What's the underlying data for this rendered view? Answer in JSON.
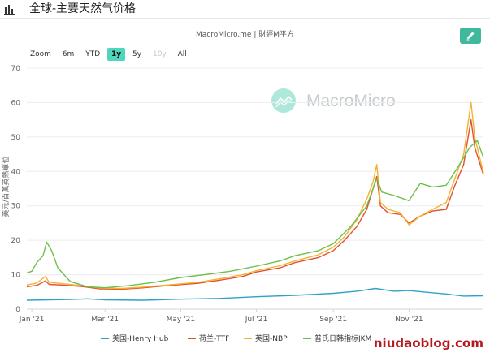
{
  "header": {
    "title": "全球-主要天然气价格",
    "icon": "bar-chart-icon"
  },
  "chart_source": "MacroMicro.me | 財經M平方",
  "brand": "MacroMicro",
  "zoom": {
    "label": "Zoom",
    "options": [
      "6m",
      "YTD",
      "1y",
      "5y",
      "10y",
      "All"
    ],
    "active": "1y",
    "disabled": [
      "10y"
    ]
  },
  "watermark": "niudaoblog.com",
  "colors": {
    "accent": "#4fd6bd",
    "edit_button": "#3fb89d"
  },
  "chart_data": {
    "type": "line",
    "title": "",
    "ylabel": "美元/百萬英熱單位",
    "ylim": [
      0,
      70
    ],
    "yticks": [
      0,
      10,
      20,
      30,
      40,
      50,
      60,
      70
    ],
    "xlim": [
      "2020-12-28",
      "2021-12-31"
    ],
    "xticks": [
      {
        "date": "2021-01-01",
        "label": "Jan '21"
      },
      {
        "date": "2021-03-01",
        "label": "Mar '21"
      },
      {
        "date": "2021-05-01",
        "label": "May '21"
      },
      {
        "date": "2021-07-01",
        "label": "Jul '21"
      },
      {
        "date": "2021-09-01",
        "label": "Sep '21"
      },
      {
        "date": "2021-11-01",
        "label": "Nov '21"
      }
    ],
    "grid": "horizontal",
    "legend_position": "bottom",
    "series": [
      {
        "name": "美国-Henry Hub",
        "color": "#2fa3c4",
        "points": [
          [
            "2020-12-28",
            2.6
          ],
          [
            "2021-01-15",
            2.7
          ],
          [
            "2021-02-01",
            2.8
          ],
          [
            "2021-02-15",
            3.0
          ],
          [
            "2021-03-01",
            2.7
          ],
          [
            "2021-04-01",
            2.6
          ],
          [
            "2021-05-01",
            2.9
          ],
          [
            "2021-06-01",
            3.1
          ],
          [
            "2021-07-01",
            3.6
          ],
          [
            "2021-08-01",
            4.0
          ],
          [
            "2021-09-01",
            4.6
          ],
          [
            "2021-09-20",
            5.2
          ],
          [
            "2021-10-05",
            6.0
          ],
          [
            "2021-10-20",
            5.2
          ],
          [
            "2021-11-01",
            5.4
          ],
          [
            "2021-11-15",
            4.9
          ],
          [
            "2021-12-01",
            4.4
          ],
          [
            "2021-12-15",
            3.8
          ],
          [
            "2021-12-31",
            3.9
          ]
        ]
      },
      {
        "name": "荷兰-TTF",
        "color": "#e0522d",
        "points": [
          [
            "2020-12-28",
            6.5
          ],
          [
            "2021-01-05",
            6.9
          ],
          [
            "2021-01-12",
            8.2
          ],
          [
            "2021-01-15",
            7.2
          ],
          [
            "2021-01-25",
            7.0
          ],
          [
            "2021-02-10",
            6.6
          ],
          [
            "2021-02-25",
            5.9
          ],
          [
            "2021-03-15",
            5.8
          ],
          [
            "2021-04-01",
            6.2
          ],
          [
            "2021-04-20",
            6.8
          ],
          [
            "2021-05-15",
            7.5
          ],
          [
            "2021-06-01",
            8.4
          ],
          [
            "2021-06-20",
            9.5
          ],
          [
            "2021-07-01",
            10.8
          ],
          [
            "2021-07-20",
            12.0
          ],
          [
            "2021-08-01",
            13.5
          ],
          [
            "2021-08-20",
            15.0
          ],
          [
            "2021-09-01",
            17.0
          ],
          [
            "2021-09-10",
            20.0
          ],
          [
            "2021-09-20",
            24.0
          ],
          [
            "2021-09-28",
            29.0
          ],
          [
            "2021-10-03",
            35.0
          ],
          [
            "2021-10-06",
            38.5
          ],
          [
            "2021-10-09",
            30.0
          ],
          [
            "2021-10-15",
            28.0
          ],
          [
            "2021-10-25",
            27.5
          ],
          [
            "2021-11-01",
            25.0
          ],
          [
            "2021-11-10",
            27.0
          ],
          [
            "2021-11-20",
            28.5
          ],
          [
            "2021-12-01",
            29.0
          ],
          [
            "2021-12-08",
            36.0
          ],
          [
            "2021-12-15",
            42.0
          ],
          [
            "2021-12-21",
            55.0
          ],
          [
            "2021-12-24",
            47.0
          ],
          [
            "2021-12-31",
            39.0
          ]
        ]
      },
      {
        "name": "英国-NBP",
        "color": "#f2b233",
        "points": [
          [
            "2020-12-28",
            7.0
          ],
          [
            "2021-01-05",
            7.6
          ],
          [
            "2021-01-12",
            9.5
          ],
          [
            "2021-01-15",
            7.8
          ],
          [
            "2021-01-25",
            7.4
          ],
          [
            "2021-02-10",
            6.8
          ],
          [
            "2021-02-25",
            6.1
          ],
          [
            "2021-03-15",
            6.0
          ],
          [
            "2021-04-01",
            6.4
          ],
          [
            "2021-04-20",
            7.0
          ],
          [
            "2021-05-15",
            7.8
          ],
          [
            "2021-06-01",
            8.8
          ],
          [
            "2021-06-20",
            10.0
          ],
          [
            "2021-07-01",
            11.2
          ],
          [
            "2021-07-20",
            12.6
          ],
          [
            "2021-08-01",
            14.0
          ],
          [
            "2021-08-20",
            15.8
          ],
          [
            "2021-09-01",
            18.0
          ],
          [
            "2021-09-10",
            21.0
          ],
          [
            "2021-09-20",
            26.0
          ],
          [
            "2021-09-28",
            32.0
          ],
          [
            "2021-10-03",
            37.0
          ],
          [
            "2021-10-06",
            42.0
          ],
          [
            "2021-10-09",
            31.0
          ],
          [
            "2021-10-15",
            29.0
          ],
          [
            "2021-10-25",
            28.0
          ],
          [
            "2021-11-01",
            24.5
          ],
          [
            "2021-11-10",
            27.0
          ],
          [
            "2021-11-20",
            29.0
          ],
          [
            "2021-12-01",
            31.0
          ],
          [
            "2021-12-08",
            38.0
          ],
          [
            "2021-12-15",
            45.0
          ],
          [
            "2021-12-21",
            60.0
          ],
          [
            "2021-12-24",
            50.0
          ],
          [
            "2021-12-31",
            39.5
          ]
        ]
      },
      {
        "name": "普氏日韩指标JKM",
        "color": "#6cc04a",
        "points": [
          [
            "2020-12-28",
            10.5
          ],
          [
            "2021-01-01",
            11.0
          ],
          [
            "2021-01-05",
            13.5
          ],
          [
            "2021-01-10",
            15.5
          ],
          [
            "2021-01-13",
            19.5
          ],
          [
            "2021-01-17",
            17.0
          ],
          [
            "2021-01-22",
            12.0
          ],
          [
            "2021-02-01",
            8.0
          ],
          [
            "2021-02-15",
            6.5
          ],
          [
            "2021-03-01",
            6.2
          ],
          [
            "2021-03-20",
            6.8
          ],
          [
            "2021-04-10",
            7.8
          ],
          [
            "2021-05-01",
            9.2
          ],
          [
            "2021-05-20",
            10.0
          ],
          [
            "2021-06-10",
            11.0
          ],
          [
            "2021-07-01",
            12.5
          ],
          [
            "2021-07-20",
            14.0
          ],
          [
            "2021-08-01",
            15.5
          ],
          [
            "2021-08-20",
            17.0
          ],
          [
            "2021-09-01",
            19.0
          ],
          [
            "2021-09-15",
            24.0
          ],
          [
            "2021-09-28",
            30.0
          ],
          [
            "2021-10-03",
            35.0
          ],
          [
            "2021-10-06",
            38.0
          ],
          [
            "2021-10-10",
            34.0
          ],
          [
            "2021-10-20",
            33.0
          ],
          [
            "2021-11-01",
            31.5
          ],
          [
            "2021-11-10",
            36.5
          ],
          [
            "2021-11-20",
            35.5
          ],
          [
            "2021-12-01",
            36.0
          ],
          [
            "2021-12-10",
            41.0
          ],
          [
            "2021-12-20",
            47.0
          ],
          [
            "2021-12-26",
            49.0
          ],
          [
            "2021-12-31",
            44.0
          ]
        ]
      }
    ]
  }
}
